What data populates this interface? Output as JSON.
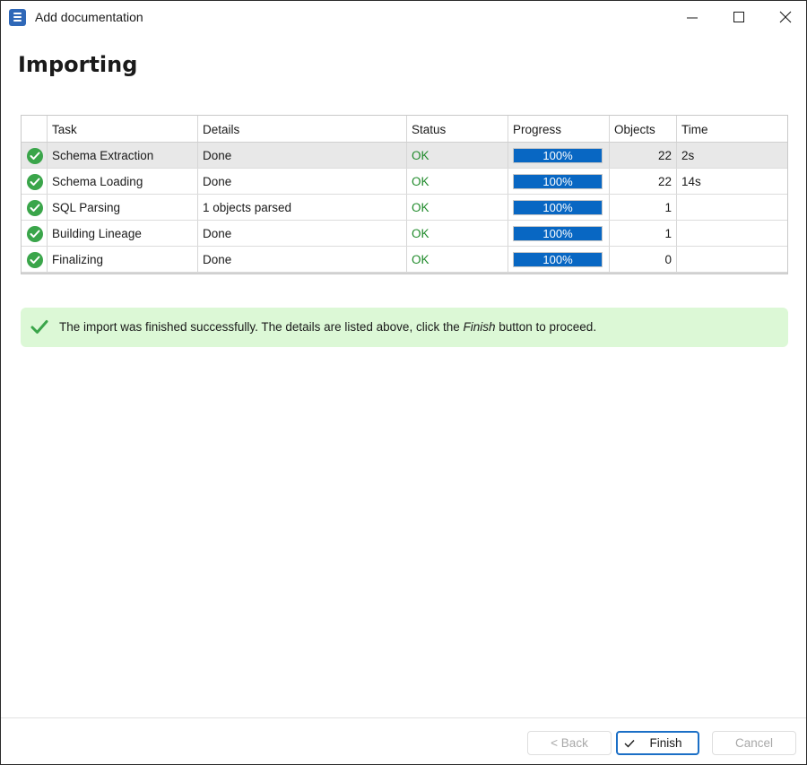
{
  "window": {
    "title": "Add documentation"
  },
  "page": {
    "heading": "Importing"
  },
  "table": {
    "headers": [
      "Task",
      "Details",
      "Status",
      "Progress",
      "Objects",
      "Time"
    ],
    "rows": [
      {
        "task": "Schema Extraction",
        "details": "Done",
        "status": "OK",
        "progress": "100%",
        "progress_value": 100,
        "objects": "22",
        "time": "2s"
      },
      {
        "task": "Schema Loading",
        "details": "Done",
        "status": "OK",
        "progress": "100%",
        "progress_value": 100,
        "objects": "22",
        "time": "14s"
      },
      {
        "task": "SQL Parsing",
        "details": "1 objects parsed",
        "status": "OK",
        "progress": "100%",
        "progress_value": 100,
        "objects": "1",
        "time": ""
      },
      {
        "task": "Building Lineage",
        "details": "Done",
        "status": "OK",
        "progress": "100%",
        "progress_value": 100,
        "objects": "1",
        "time": ""
      },
      {
        "task": "Finalizing",
        "details": "Done",
        "status": "OK",
        "progress": "100%",
        "progress_value": 100,
        "objects": "0",
        "time": ""
      }
    ],
    "selected_row": 0,
    "row_icon": "check-circle-icon"
  },
  "notice": {
    "text_before": "The import was finished successfully. The details are listed above, click the ",
    "emphasis": "Finish",
    "text_after": " button to proceed.",
    "icon": "checkmark-icon"
  },
  "buttons": {
    "back": "< Back",
    "finish": "Finish",
    "cancel": "Cancel"
  },
  "colors": {
    "accent": "#0867c3",
    "success": "#3aa54a",
    "ok_text": "#1f8a2a",
    "notice_bg": "#dcf8d6"
  }
}
